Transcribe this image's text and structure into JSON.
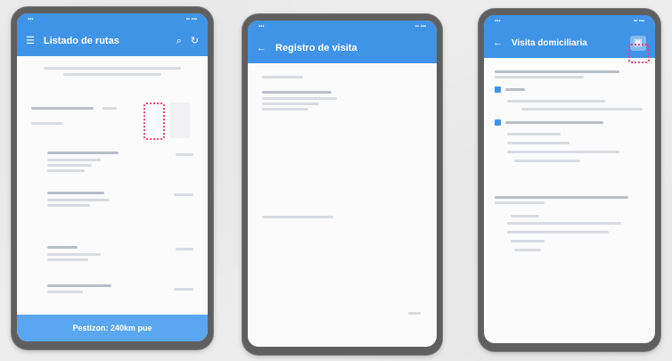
{
  "colors": {
    "primary": "#3f94e8",
    "highlight": "#e8457a",
    "bezel": "#5f5f5f"
  },
  "phone1": {
    "status_left": "▪▪▪",
    "status_right": "▪▪ ▪▪▪",
    "menu_icon": "menu-icon",
    "title": "Listado de rutas",
    "search_icon": "search-icon",
    "refresh_icon": "refresh-icon",
    "header_text": "───────────────────",
    "filter_label": "······· ·····",
    "items": [
      {
        "title": "········ ·· ·······",
        "sub": "······ ·····",
        "value": "······"
      },
      {
        "title": "······ ·· ······",
        "sub": "········",
        "value": "······"
      },
      {
        "title": "·······",
        "sub": "······ ·····",
        "value": "······"
      },
      {
        "title": "········ ·· ·······",
        "sub": "·······",
        "value": "······"
      }
    ],
    "bottom_button": "Pestizon: 240km pue"
  },
  "phone2": {
    "status_left": "▪▪▪",
    "status_right": "▪▪ ▪▪▪",
    "back_icon": "back-arrow-icon",
    "title": "Registro de visita",
    "label1": "·········",
    "label2": "····· ········· ··· ·······",
    "label3": "········· ········",
    "label4": "········· ······"
  },
  "phone3": {
    "status_left": "▪▪▪",
    "status_right": "▪▪ ▪▪▪",
    "back_icon": "back-arrow-icon",
    "title": "Visita domiciliaria",
    "action_icon": "save-icon"
  }
}
